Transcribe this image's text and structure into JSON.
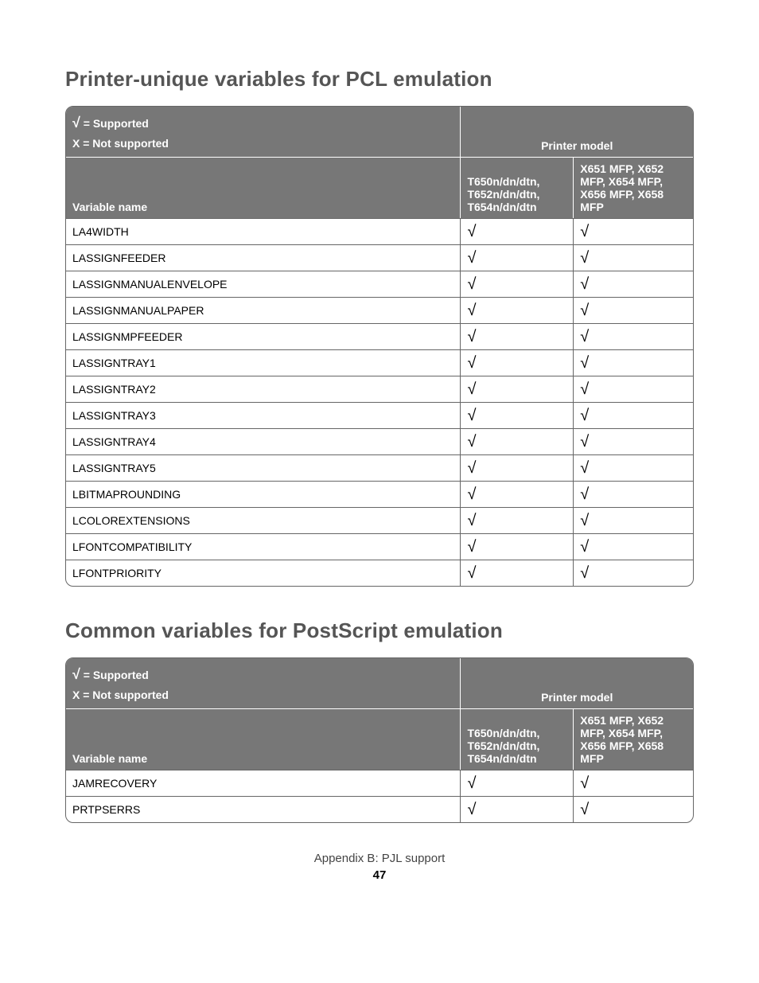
{
  "section1": {
    "heading": "Printer-unique variables for PCL emulation",
    "legend": {
      "supported_symbol": "√",
      "supported_label": " = Supported",
      "not_supported_label": "X = Not supported"
    },
    "printer_model_label": "Printer model",
    "variable_name_label": "Variable name",
    "model1": "T650n/dn/dtn, T652n/dn/dtn, T654n/dn/dtn",
    "model2": "X651 MFP, X652 MFP, X654 MFP, X656 MFP, X658 MFP",
    "rows": [
      {
        "name": "LA4WIDTH",
        "m1": "√",
        "m2": "√"
      },
      {
        "name": "LASSIGNFEEDER",
        "m1": "√",
        "m2": "√"
      },
      {
        "name": "LASSIGNMANUALENVELOPE",
        "m1": "√",
        "m2": "√"
      },
      {
        "name": "LASSIGNMANUALPAPER",
        "m1": "√",
        "m2": "√"
      },
      {
        "name": "LASSIGNMPFEEDER",
        "m1": "√",
        "m2": "√"
      },
      {
        "name": "LASSIGNTRAY1",
        "m1": "√",
        "m2": "√"
      },
      {
        "name": "LASSIGNTRAY2",
        "m1": "√",
        "m2": "√"
      },
      {
        "name": "LASSIGNTRAY3",
        "m1": "√",
        "m2": "√"
      },
      {
        "name": "LASSIGNTRAY4",
        "m1": "√",
        "m2": "√"
      },
      {
        "name": "LASSIGNTRAY5",
        "m1": "√",
        "m2": "√"
      },
      {
        "name": "LBITMAPROUNDING",
        "m1": "√",
        "m2": "√"
      },
      {
        "name": "LCOLOREXTENSIONS",
        "m1": "√",
        "m2": "√"
      },
      {
        "name": "LFONTCOMPATIBILITY",
        "m1": "√",
        "m2": "√"
      },
      {
        "name": "LFONTPRIORITY",
        "m1": "√",
        "m2": "√"
      }
    ]
  },
  "section2": {
    "heading": "Common variables for PostScript emulation",
    "legend": {
      "supported_symbol": "√",
      "supported_label": " = Supported",
      "not_supported_label": "X = Not supported"
    },
    "printer_model_label": "Printer model",
    "variable_name_label": "Variable name",
    "model1": "T650n/dn/dtn, T652n/dn/dtn, T654n/dn/dtn",
    "model2": "X651 MFP, X652 MFP, X654 MFP, X656 MFP, X658 MFP",
    "rows": [
      {
        "name": "JAMRECOVERY",
        "m1": "√",
        "m2": "√"
      },
      {
        "name": "PRTPSERRS",
        "m1": "√",
        "m2": "√"
      }
    ]
  },
  "footer": {
    "title": "Appendix B: PJL support",
    "page": "47"
  }
}
